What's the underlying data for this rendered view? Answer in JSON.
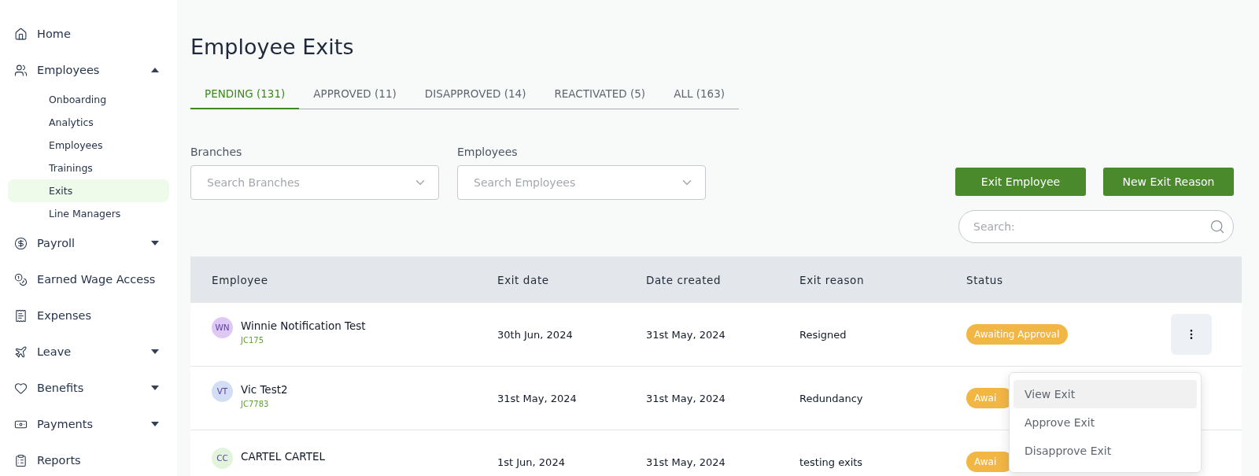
{
  "sidebar": {
    "items": [
      {
        "label": "Home"
      },
      {
        "label": "Employees",
        "expanded": true,
        "children": [
          {
            "label": "Onboarding",
            "selected": false
          },
          {
            "label": "Analytics",
            "selected": false
          },
          {
            "label": "Employees",
            "selected": false
          },
          {
            "label": "Trainings",
            "selected": false
          },
          {
            "label": "Exits",
            "selected": true
          },
          {
            "label": "Line Managers",
            "selected": false
          }
        ]
      },
      {
        "label": "Payroll",
        "expanded": false
      },
      {
        "label": "Earned Wage Access"
      },
      {
        "label": "Expenses"
      },
      {
        "label": "Leave",
        "expanded": false
      },
      {
        "label": "Benefits",
        "expanded": false
      },
      {
        "label": "Payments",
        "expanded": false
      },
      {
        "label": "Reports"
      }
    ]
  },
  "page": {
    "title": "Employee Exits"
  },
  "tabs": [
    {
      "label": "PENDING (131)",
      "selected": true
    },
    {
      "label": "APPROVED (11)",
      "selected": false
    },
    {
      "label": "DISAPPROVED (14)",
      "selected": false
    },
    {
      "label": "REACTIVATED (5)",
      "selected": false
    },
    {
      "label": "ALL (163)",
      "selected": false
    }
  ],
  "filters": [
    {
      "label": "Branches",
      "placeholder": "Search Branches"
    },
    {
      "label": "Employees",
      "placeholder": "Search Employees"
    }
  ],
  "actions": [
    "Exit Employee",
    "New Exit Reason"
  ],
  "search": {
    "placeholder": "Search:"
  },
  "table": {
    "columns": [
      "Employee",
      "Exit date",
      "Date created",
      "Exit reason",
      "Status"
    ],
    "rows": [
      {
        "initials": "WN",
        "color": "#e0c8f5",
        "name": "Winnie Notification Test",
        "code": "JC175",
        "exit_date": "30th Jun, 2024",
        "date_created": "31st May, 2024",
        "exit_reason": "Resigned",
        "status": "Awaiting Approval",
        "menu_button": true
      },
      {
        "initials": "VT",
        "color": "#d3ddf3",
        "name": "Vic Test2",
        "code": "JC7783",
        "exit_date": "31st May, 2024",
        "date_created": "31st May, 2024",
        "exit_reason": "Redundancy",
        "status": "Awai",
        "menu_button": false
      },
      {
        "initials": "CC",
        "color": "#e2f5dc",
        "name": "CARTEL CARTEL",
        "exit_date": "1st Jun, 2024",
        "date_created": "31st May, 2024",
        "exit_reason": "testing exits",
        "status": "Awai",
        "menu_button": false
      }
    ]
  },
  "row_menu": {
    "items": [
      {
        "label": "View Exit",
        "selected": true
      },
      {
        "label": "Approve Exit",
        "selected": false
      },
      {
        "label": "Disapprove Exit",
        "selected": false
      }
    ]
  }
}
